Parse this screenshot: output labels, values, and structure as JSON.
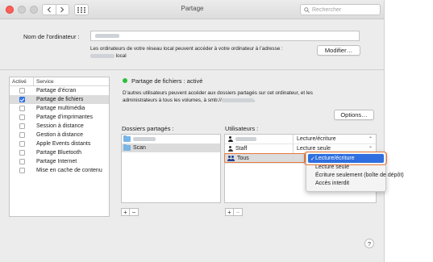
{
  "window": {
    "title": "Partage"
  },
  "toolbar": {
    "back_icon": "chevron-left-icon",
    "forward_icon": "chevron-right-icon",
    "grid_icon": "grid-icon",
    "search_placeholder": "Rechercher"
  },
  "computer_name": {
    "label": "Nom de l’ordinateur :",
    "note_prefix": "Les ordinateurs de votre réseau local peuvent accéder à votre ordinateur à l’adresse :",
    "note_suffix": "local",
    "modify_button": "Modifier…"
  },
  "services": {
    "header_active": "Activé",
    "header_service": "Service",
    "items": [
      {
        "label": "Partage d’écran",
        "checked": false,
        "selected": false
      },
      {
        "label": "Partage de fichiers",
        "checked": true,
        "selected": true
      },
      {
        "label": "Partage multimédia",
        "checked": false,
        "selected": false
      },
      {
        "label": "Partage d’imprimantes",
        "checked": false,
        "selected": false
      },
      {
        "label": "Session à distance",
        "checked": false,
        "selected": false
      },
      {
        "label": "Gestion à distance",
        "checked": false,
        "selected": false
      },
      {
        "label": "Apple Events distants",
        "checked": false,
        "selected": false
      },
      {
        "label": "Partage Bluetooth",
        "checked": false,
        "selected": false
      },
      {
        "label": "Partage Internet",
        "checked": false,
        "selected": false
      },
      {
        "label": "Mise en cache de contenu",
        "checked": false,
        "selected": false
      }
    ]
  },
  "status": {
    "title": "Partage de fichiers : activé",
    "color": "#2dbf3a",
    "description_1": "D’autres utilisateurs peuvent accéder aux dossiers partagés sur cet ordinateur, et les",
    "description_2": "administrateurs à tous les volumes, à smb://",
    "description_3": ".",
    "options_button": "Options…"
  },
  "shared_folders": {
    "label": "Dossiers partagés :",
    "items": [
      {
        "name": "",
        "blurred": true
      },
      {
        "name": "Scan",
        "blurred": false
      }
    ]
  },
  "users": {
    "label": "Utilisateurs :",
    "items": [
      {
        "name": "",
        "blurred": true,
        "permission": "Lecture/écriture",
        "icon": "person-icon"
      },
      {
        "name": "Staff",
        "blurred": false,
        "permission": "Lecture seule",
        "icon": "person-icon"
      },
      {
        "name": "Tous",
        "blurred": false,
        "permission": "",
        "icon": "group-icon"
      }
    ]
  },
  "permission_menu": {
    "options": [
      {
        "label": "Lecture/écriture",
        "checked": true
      },
      {
        "label": "Lecture seule",
        "checked": false
      },
      {
        "label": "Écriture seulement (boîte de dépôt)",
        "checked": false
      },
      {
        "label": "Accès interdit",
        "checked": false
      }
    ],
    "check_mark": "✓"
  },
  "controls": {
    "add": "+",
    "remove": "−",
    "help": "?"
  },
  "colors": {
    "accent": "#2f6fe0",
    "highlight_outline": "#e8773a"
  }
}
